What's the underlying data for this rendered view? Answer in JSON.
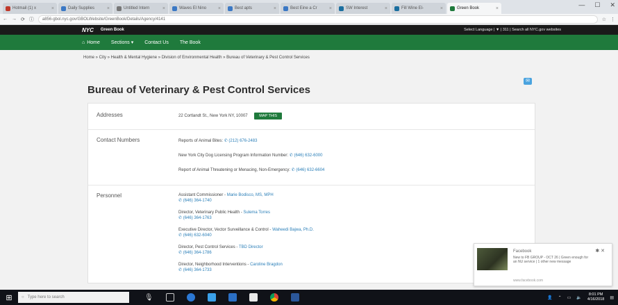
{
  "browser": {
    "tabs": [
      {
        "label": "Hotmail (1) x",
        "color": "#c0392b"
      },
      {
        "label": "Daily Supplies",
        "color": "#3b78c4"
      },
      {
        "label": "Untitled Intern",
        "color": "#777777"
      },
      {
        "label": "Waves El Nino",
        "color": "#3b78c4"
      },
      {
        "label": "Best apts ",
        "color": "#3b78c4"
      },
      {
        "label": "Best Eine a Cr",
        "color": "#3b78c4"
      },
      {
        "label": "SW Interest",
        "color": "#1a6e9f"
      },
      {
        "label": "Fill Wine El-",
        "color": "#1a6e9f"
      },
      {
        "label": "Green Book",
        "color": "#1f7a3c",
        "active": true
      }
    ],
    "url": "a856-gbol.nyc.gov/GBOLWebsite/GreenBook/Details/Agency/4141",
    "window_controls": {
      "minimize": "—",
      "maximize": "☐",
      "close": "✕"
    }
  },
  "nyc_bar": {
    "logo": "NYC",
    "site": "Green Book",
    "right": "Select Language  |  ▼  |  311  |  Search all NYC.gov websites"
  },
  "nav": {
    "items": [
      {
        "label": "Home",
        "icon": "home-icon"
      },
      {
        "label": "Sections ▾"
      },
      {
        "label": "Contact Us"
      },
      {
        "label": "The Book"
      }
    ]
  },
  "breadcrumb": "Home  »  City  »  Health & Mental Hygiene  »  Division of Environmental Health  »  Bureau of Veterinary & Pest Control Services",
  "page": {
    "title": "Bureau of Veterinary & Pest Control Services",
    "share_label": "✉"
  },
  "addresses": {
    "label": "Addresses",
    "value": "22 Cortlandt St., New York NY, 10007",
    "map_button": "MAP THIS"
  },
  "contacts": {
    "label": "Contact Numbers",
    "items": [
      {
        "text": "Reports of Animal Bites:",
        "phone": "(212) 676-2483"
      },
      {
        "text": "New York City Dog Licensing Program Information Number:",
        "phone": "(646) 632-6000"
      },
      {
        "text": "Report of Animal Threatening or Menacing, Non-Emergency:",
        "phone": "(646) 632-6604"
      }
    ]
  },
  "personnel": {
    "label": "Personnel",
    "items": [
      {
        "title": "Assistant Commissioner",
        "name": "Marie Bodisco, MS, MPH",
        "phone": "(646) 364-1740"
      },
      {
        "title": "Director, Veterinary Public Health",
        "name": "Sulema Torres",
        "phone": "(646) 364-1763"
      },
      {
        "title": "Executive Director, Vector Surveillance & Control",
        "name": "Waheedi Bajwa, Ph.D.",
        "phone": "(646) 632-6040"
      },
      {
        "title": "Director, Pest Control Services",
        "name": "TBD Director",
        "phone": "(646) 364-1786"
      },
      {
        "title": "Director, Neighborhood Interventions",
        "name": "Caroline Bragdon",
        "phone": "(646) 364-1733"
      }
    ]
  },
  "notification": {
    "title": "Facebook",
    "text": "New to FB GROUP - OCT 26 | Green enough for an NU service | 1 other new message",
    "url": "www.facebook.com"
  },
  "taskbar": {
    "search_placeholder": "Type here to search",
    "time": "8:01 PM",
    "date": "4/16/2018"
  }
}
